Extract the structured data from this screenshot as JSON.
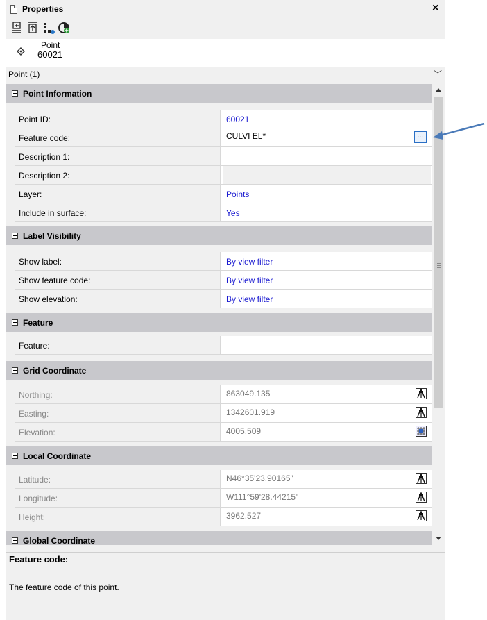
{
  "window": {
    "title": "Properties",
    "close_label": "×"
  },
  "toolbar": {
    "buttons": [
      "zoom-to-icon",
      "move-up-icon",
      "report-icon",
      "add-icon"
    ]
  },
  "selection": {
    "type": "Point",
    "id": "60021",
    "selector_value": "Point (1)"
  },
  "categories": {
    "point_info": {
      "label": "Point Information",
      "rows": [
        {
          "name": "Point ID:",
          "value": "60021"
        },
        {
          "name": "Feature code:",
          "value": "CULVI EL*",
          "button": "..."
        },
        {
          "name": "Description 1:",
          "value": ""
        },
        {
          "name": "Description 2:",
          "value": ""
        },
        {
          "name": "Layer:",
          "value": "Points"
        },
        {
          "name": "Include in surface:",
          "value": "Yes"
        }
      ]
    },
    "label_visibility": {
      "label": "Label Visibility",
      "rows": [
        {
          "name": "Show label:",
          "value": "By view filter"
        },
        {
          "name": "Show feature code:",
          "value": "By view filter"
        },
        {
          "name": "Show elevation:",
          "value": "By view filter"
        }
      ]
    },
    "feature": {
      "label": "Feature",
      "rows": [
        {
          "name": "Feature:",
          "value": ""
        }
      ]
    },
    "grid_coordinate": {
      "label": "Grid Coordinate",
      "rows": [
        {
          "name": "Northing:",
          "value": "863049.135"
        },
        {
          "name": "Easting:",
          "value": "1342601.919"
        },
        {
          "name": "Elevation:",
          "value": "4005.509"
        }
      ]
    },
    "local_coordinate": {
      "label": "Local Coordinate",
      "rows": [
        {
          "name": "Latitude:",
          "value": "N46°35'23.90165\""
        },
        {
          "name": "Longitude:",
          "value": "W111°59'28.44215\""
        },
        {
          "name": "Height:",
          "value": "3962.527"
        }
      ]
    },
    "global_coordinate": {
      "label": "Global Coordinate"
    }
  },
  "description": {
    "title": "Feature code:",
    "text": "The feature code of this point."
  },
  "colors": {
    "link_blue": "#1b1bd0",
    "category_bg": "#c8c8cc",
    "arrow": "#4a7ab8"
  }
}
